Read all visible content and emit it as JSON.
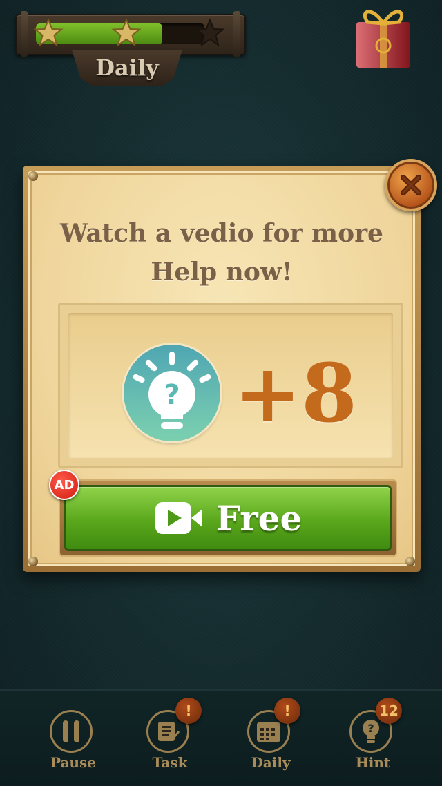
{
  "header": {
    "progress_fraction": 0.75,
    "stars": [
      {
        "state": "earned",
        "icon": "star-filled"
      },
      {
        "state": "earned",
        "icon": "star-filled"
      },
      {
        "state": "empty",
        "icon": "star-empty"
      }
    ],
    "tab_label": "Daily",
    "gift_icon": "gift-box-icon"
  },
  "dialog": {
    "title_line1": "Watch a vedio for more",
    "title_line2": "Help now!",
    "reward_icon": "hint-bulb-icon",
    "reward_amount": "+8",
    "button_label": "Free",
    "button_icon": "video-camera-icon",
    "ad_badge": "AD",
    "close_icon": "close-icon"
  },
  "bottom_bar": {
    "items": [
      {
        "label": "Pause",
        "icon": "pause-icon",
        "badge": ""
      },
      {
        "label": "Task",
        "icon": "task-icon",
        "badge": "!"
      },
      {
        "label": "Daily",
        "icon": "calendar-icon",
        "badge": "!"
      },
      {
        "label": "Hint",
        "icon": "hint-icon",
        "badge": "12"
      }
    ]
  },
  "colors": {
    "background": "#142b2e",
    "accent_green": "#5aa71c",
    "reward_orange": "#c46a1c",
    "badge_red": "#d11a10",
    "label_gold": "#a98c5a"
  }
}
